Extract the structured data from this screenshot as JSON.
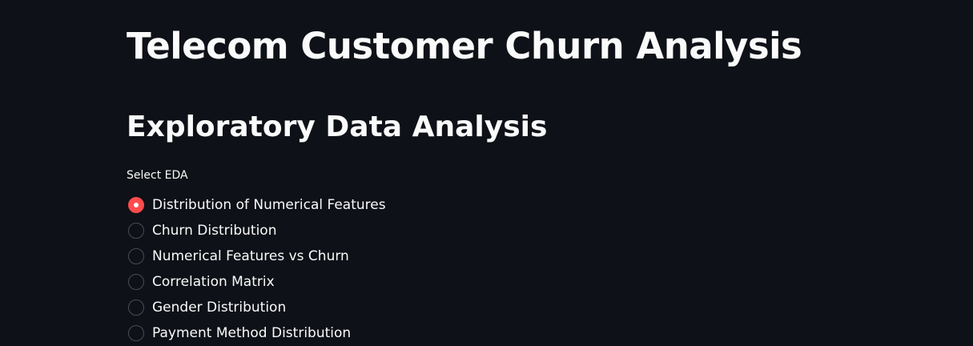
{
  "page": {
    "title": "Telecom Customer Churn Analysis",
    "section_heading": "Exploratory Data Analysis"
  },
  "eda_select": {
    "label": "Select EDA",
    "selected_index": 0,
    "options": [
      {
        "label": "Distribution of Numerical Features",
        "checked": true
      },
      {
        "label": "Churn Distribution",
        "checked": false
      },
      {
        "label": "Numerical Features vs Churn",
        "checked": false
      },
      {
        "label": "Correlation Matrix",
        "checked": false
      },
      {
        "label": "Gender Distribution",
        "checked": false
      },
      {
        "label": "Payment Method Distribution",
        "checked": false
      }
    ]
  },
  "colors": {
    "background": "#0e1117",
    "text": "#fafafa",
    "accent": "#ff4b4b",
    "radio_border": "#4a4d57"
  }
}
